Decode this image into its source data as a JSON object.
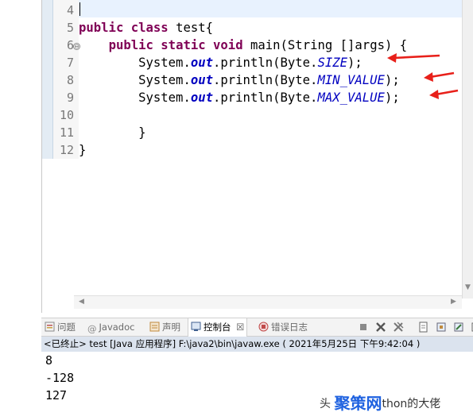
{
  "editor": {
    "line_numbers": [
      "4",
      "5",
      "6",
      "7",
      "8",
      "9",
      "10",
      "11",
      "12"
    ],
    "fold_marker": "⊖",
    "code": {
      "l5_kw1": "public",
      "l5_kw2": "class",
      "l5_rest": " test{",
      "l6_kw1": "public",
      "l6_kw2": "static",
      "l6_kw3": "void",
      "l6_rest": " main(String []args) {",
      "println_prefix": "System.",
      "out_field": "out",
      "println_mid": ".println(Byte.",
      "println_suffix": ");",
      "const_size": "SIZE",
      "const_min": "MIN_VALUE",
      "const_max": "MAX_VALUE",
      "close_method": "}",
      "close_class": "}"
    },
    "annotation_color": "#e8201a"
  },
  "console_tabs": {
    "problems": "问题",
    "javadoc": "Javadoc",
    "declaration": "声明",
    "console": "控制台",
    "error_log": "错误日志"
  },
  "console": {
    "header": "<已终止> test [Java 应用程序] F:\\java2\\bin\\javaw.exe ( 2021年5月25日 下午9:42:04 )",
    "output": [
      "8",
      "-128",
      "127"
    ]
  },
  "watermark": {
    "prefix": "头",
    "brand": "聚策网",
    "suffix": "thon的大佬"
  },
  "colors": {
    "keyword": "#7f0055",
    "field": "#0000c0",
    "console_header_bg": "#dbe3ee",
    "current_line": "#e8f2fe"
  }
}
